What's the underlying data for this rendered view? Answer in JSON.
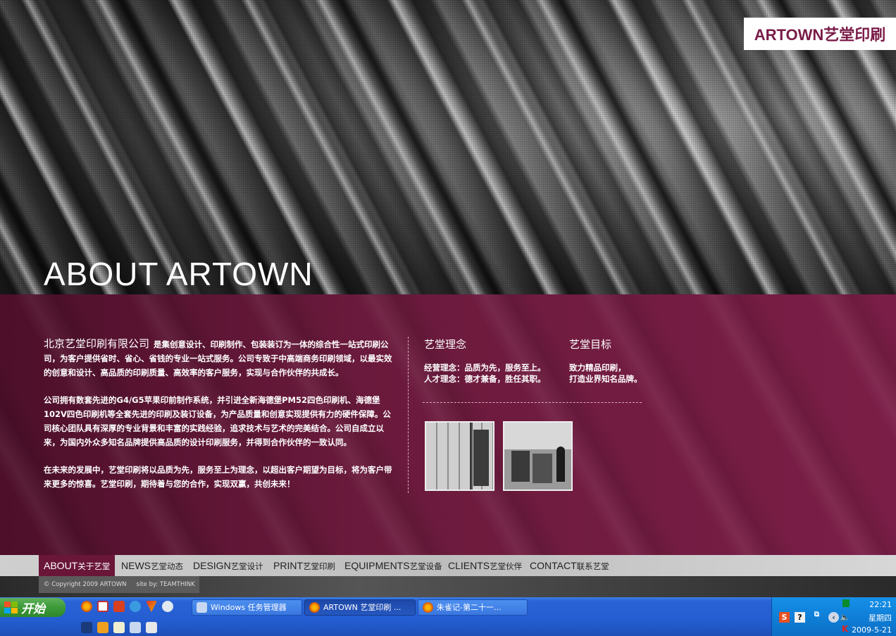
{
  "brand": {
    "logo_text": "ARTOWN艺堂印刷",
    "accent": "#7a1b47"
  },
  "hero": {
    "title": "ABOUT ARTOWN"
  },
  "intro": {
    "company_name": "北京艺堂印刷有限公司",
    "p1_rest": "是集创意设计、印刷制作、包装装订为一体的综合性一站式印刷公司，为客户提供省时、省心、省钱的专业一站式服务。公司专致于中高端商务印刷领域，以最实效的创意和设计、高品质的印刷质量、高效率的客户服务，实现与合作伙伴的共成长。",
    "p2": "公司拥有数套先进的G4/G5苹果印前制作系统，并引进全新海德堡PM52四色印刷机、海德堡102V四色印刷机等全套先进的印刷及装订设备，为产品质量和创意实现提供有力的硬件保障。公司核心团队具有深厚的专业背景和丰富的实践经验，追求技术与艺术的完美结合。公司自成立以来，为国内外众多知名品牌提供高品质的设计印刷服务，并得到合作伙伴的一致认同。",
    "p3": "在未来的发展中，艺堂印刷将以品质为先，服务至上为理念，以超出客户期望为目标，将为客户带来更多的惊喜。艺堂印刷，期待着与您的合作，实现双赢，共创未来！"
  },
  "philosophy": {
    "title": "艺堂理念",
    "line1": "经营理念：品质为先，服务至上。",
    "line2": "人才理念：德才兼备，胜任其职。"
  },
  "goal": {
    "title": "艺堂目标",
    "line1": "致力精品印刷，",
    "line2": "打造业界知名品牌。"
  },
  "nav": {
    "items": [
      {
        "en": "ABOUT",
        "cn": "关于艺堂"
      },
      {
        "en": "NEWS",
        "cn": "艺堂动态"
      },
      {
        "en": "DESIGN",
        "cn": "艺堂设计"
      },
      {
        "en": "PRINT",
        "cn": "艺堂印刷"
      },
      {
        "en": "EQUIPMENTS",
        "cn": "艺堂设备"
      },
      {
        "en": "CLIENTS",
        "cn": "艺堂伙伴"
      },
      {
        "en": "CONTACT",
        "cn": "联系艺堂"
      }
    ]
  },
  "footer": {
    "copyright": "© Copyright 2009 ARTOWN",
    "site_by": "site by: TEAMTHINK"
  },
  "taskbar": {
    "start_label": "开始",
    "tasks": [
      {
        "label": "Windows 任务管理器",
        "icon": "task-manager-icon"
      },
      {
        "label": "ARTOWN 艺堂印刷 ...",
        "icon": "firefox-icon"
      },
      {
        "label": "朱雀记-第二十一...",
        "icon": "firefox-icon"
      }
    ],
    "tray_ime": "S",
    "tray_help": "?",
    "clock_time": "22:21",
    "clock_day": "星期四",
    "clock_date": "2009-5-21"
  }
}
